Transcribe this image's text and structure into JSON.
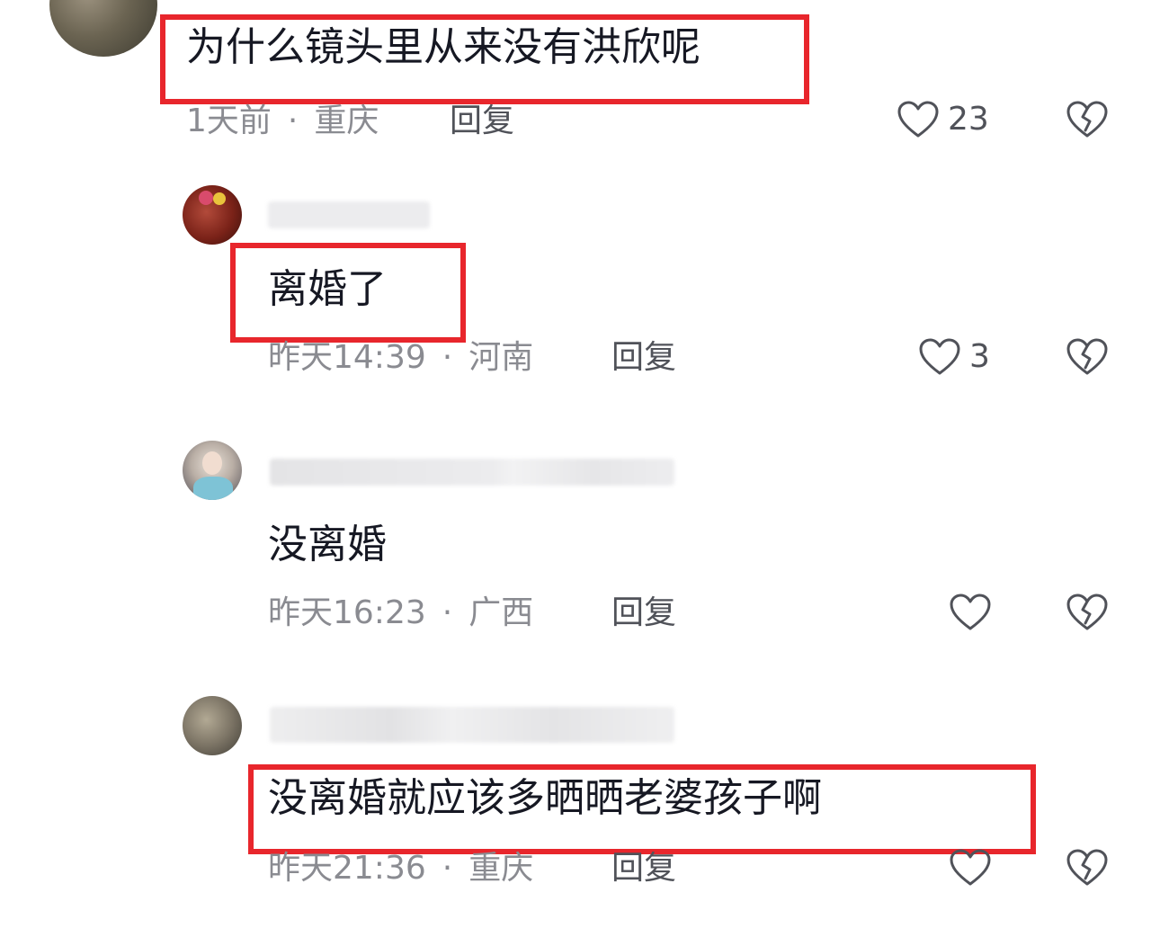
{
  "comments": [
    {
      "text": "为什么镜头里从来没有洪欣呢",
      "time": "1天前",
      "location": "重庆",
      "reply_label": "回复",
      "likes": "23",
      "highlighted": true
    },
    {
      "text": "离婚了",
      "time": "昨天14:39",
      "location": "河南",
      "reply_label": "回复",
      "likes": "3",
      "highlighted": true
    },
    {
      "text": "没离婚",
      "time": "昨天16:23",
      "location": "广西",
      "reply_label": "回复",
      "likes": "",
      "highlighted": false
    },
    {
      "text": "没离婚就应该多晒晒老婆孩子啊",
      "time": "昨天21:36",
      "location": "重庆",
      "reply_label": "回复",
      "likes": "",
      "highlighted": true
    }
  ],
  "separator": "·",
  "icons": {
    "like": "heart-outline-icon",
    "dislike": "broken-heart-icon"
  },
  "colors": {
    "highlight_box": "#e8262c",
    "text": "#161823",
    "meta": "#8a8b91",
    "action": "#505259"
  }
}
